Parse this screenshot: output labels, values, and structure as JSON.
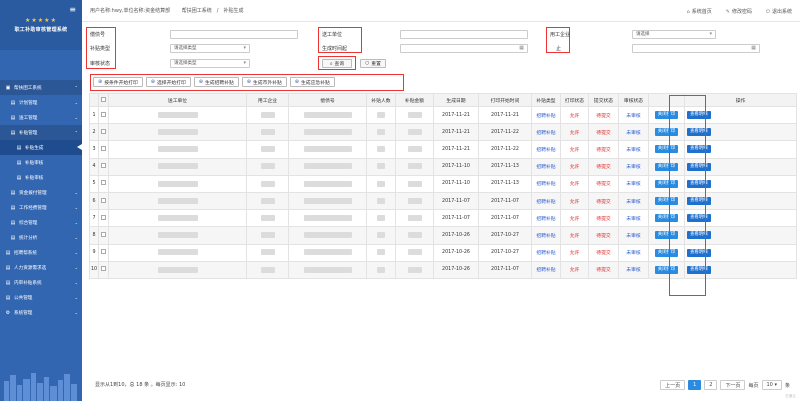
{
  "sidebar": {
    "logo_text": "职工补助审核管理系统",
    "items": [
      {
        "label": "帮扶困工系统",
        "level": 1,
        "icon": "home-icon",
        "chev": "⌃",
        "state": "active"
      },
      {
        "label": "计划管理",
        "level": 2,
        "icon": "grid-icon",
        "chev": "⌄",
        "state": ""
      },
      {
        "label": "送工管理",
        "level": 2,
        "icon": "grid-icon",
        "chev": "⌄",
        "state": ""
      },
      {
        "label": "补贴管理",
        "level": 2,
        "icon": "grid-icon",
        "chev": "⌃",
        "state": "active"
      },
      {
        "label": "补贴生成",
        "level": 3,
        "icon": "grid-icon",
        "chev": "",
        "state": "current"
      },
      {
        "label": "补贴审核",
        "level": 3,
        "icon": "grid-icon",
        "chev": "",
        "state": ""
      },
      {
        "label": "补贴审核",
        "level": 3,
        "icon": "grid-icon",
        "chev": "",
        "state": ""
      },
      {
        "label": "资金拨付管理",
        "level": 2,
        "icon": "grid-icon",
        "chev": "⌄",
        "state": ""
      },
      {
        "label": "工作经费管理",
        "level": 2,
        "icon": "grid-icon",
        "chev": "⌄",
        "state": ""
      },
      {
        "label": "综合管理",
        "level": 2,
        "icon": "grid-icon",
        "chev": "⌄",
        "state": ""
      },
      {
        "label": "统计分析",
        "level": 2,
        "icon": "grid-icon",
        "chev": "⌄",
        "state": ""
      },
      {
        "label": "招聘帮系统",
        "level": 1,
        "icon": "grid-icon",
        "chev": "⌄",
        "state": ""
      },
      {
        "label": "人力资源需求选",
        "level": 1,
        "icon": "grid-icon",
        "chev": "⌄",
        "state": ""
      },
      {
        "label": "内审补贴系统",
        "level": 1,
        "icon": "grid-icon",
        "chev": "⌄",
        "state": ""
      },
      {
        "label": "公共管理",
        "level": 1,
        "icon": "grid-icon",
        "chev": "⌄",
        "state": ""
      },
      {
        "label": "系统管理",
        "level": 1,
        "icon": "gear-icon",
        "chev": "⌄",
        "state": ""
      }
    ]
  },
  "topbar": {
    "user": "用户名称:hwy,单位名称:资金结算部",
    "breadcrumb_1": "帮扶困工系统",
    "sep": "/",
    "breadcrumb_2": "补贴生成",
    "home": "系统首页",
    "change_pwd": "修改密码",
    "logout": "退出系统"
  },
  "filters": {
    "label_doc_no": "偿债号",
    "label_subsidy_type": "补贴类型",
    "label_audit_status": "审核状态",
    "label_send_unit": "送工单位",
    "label_gen_time": "生成时间起",
    "label_employer": "用工企业",
    "label_until": "止",
    "subsidy_type_value": "请选择类型",
    "audit_status_value": "请选择类型",
    "employer_value": "请选择",
    "query_btn": "查询",
    "reset_btn": "重置"
  },
  "toolbar": {
    "btn1": "按条件开始打印",
    "btn2": "选择开始打印",
    "btn3": "生成招聘补贴",
    "btn4": "生成市外补贴",
    "btn5": "生成应急补贴"
  },
  "table": {
    "headers": [
      "",
      "",
      "送工单位",
      "用工企业",
      "偿债号",
      "补贴人数",
      "补贴金额",
      "生成日期",
      "打印开始时间",
      "补贴类型",
      "打印状态",
      "提交状态",
      "审核状态",
      "",
      "操作"
    ],
    "rows": [
      {
        "n": "1",
        "gen": "2017-11-21",
        "print": "2017-11-21",
        "type": "招聘补贴",
        "pstate": "允许",
        "sstate": "待提交",
        "astate": "未审核",
        "op1": "关闭打印",
        "op2": "查看明细"
      },
      {
        "n": "2",
        "gen": "2017-11-21",
        "print": "2017-11-22",
        "type": "招聘补贴",
        "pstate": "允许",
        "sstate": "待提交",
        "astate": "未审核",
        "op1": "关闭打印",
        "op2": "查看明细"
      },
      {
        "n": "3",
        "gen": "2017-11-21",
        "print": "2017-11-22",
        "type": "招聘补贴",
        "pstate": "允许",
        "sstate": "待提交",
        "astate": "未审核",
        "op1": "关闭打印",
        "op2": "查看明细"
      },
      {
        "n": "4",
        "gen": "2017-11-10",
        "print": "2017-11-13",
        "type": "招聘补贴",
        "pstate": "允许",
        "sstate": "待提交",
        "astate": "未审核",
        "op1": "关闭打印",
        "op2": "查看明细"
      },
      {
        "n": "5",
        "gen": "2017-11-10",
        "print": "2017-11-13",
        "type": "招聘补贴",
        "pstate": "允许",
        "sstate": "待提交",
        "astate": "未审核",
        "op1": "关闭打印",
        "op2": "查看明细"
      },
      {
        "n": "6",
        "gen": "2017-11-07",
        "print": "2017-11-07",
        "type": "招聘补贴",
        "pstate": "允许",
        "sstate": "待提交",
        "astate": "未审核",
        "op1": "关闭打印",
        "op2": "查看明细"
      },
      {
        "n": "7",
        "gen": "2017-11-07",
        "print": "2017-11-07",
        "type": "招聘补贴",
        "pstate": "允许",
        "sstate": "待提交",
        "astate": "未审核",
        "op1": "关闭打印",
        "op2": "查看明细"
      },
      {
        "n": "8",
        "gen": "2017-10-26",
        "print": "2017-10-27",
        "type": "招聘补贴",
        "pstate": "允许",
        "sstate": "待提交",
        "astate": "未审核",
        "op1": "关闭打印",
        "op2": "查看明细"
      },
      {
        "n": "9",
        "gen": "2017-10-26",
        "print": "2017-10-27",
        "type": "招聘补贴",
        "pstate": "允许",
        "sstate": "待提交",
        "astate": "未审核",
        "op1": "关闭打印",
        "op2": "查看明细"
      },
      {
        "n": "10",
        "gen": "2017-10-26",
        "print": "2017-11-07",
        "type": "招聘补贴",
        "pstate": "允许",
        "sstate": "待提交",
        "astate": "未审核",
        "op1": "关闭打印",
        "op2": "查看明细"
      }
    ]
  },
  "footer": {
    "info": "显示从1到10，总 18 条 。每页显示: 10",
    "prev": "上一页",
    "page1": "1",
    "page2": "2",
    "next": "下一页",
    "per_page_label": "每页",
    "per_page_value": "10",
    "per_page_unit": "条",
    "watermark": "亿速云"
  },
  "colors": {
    "sidebar_bg": "#3266b1",
    "highlight": "#e33333",
    "primary_btn": "#2a8be0",
    "link_blue": "#2a5ccf",
    "status_red": "#e02424"
  }
}
